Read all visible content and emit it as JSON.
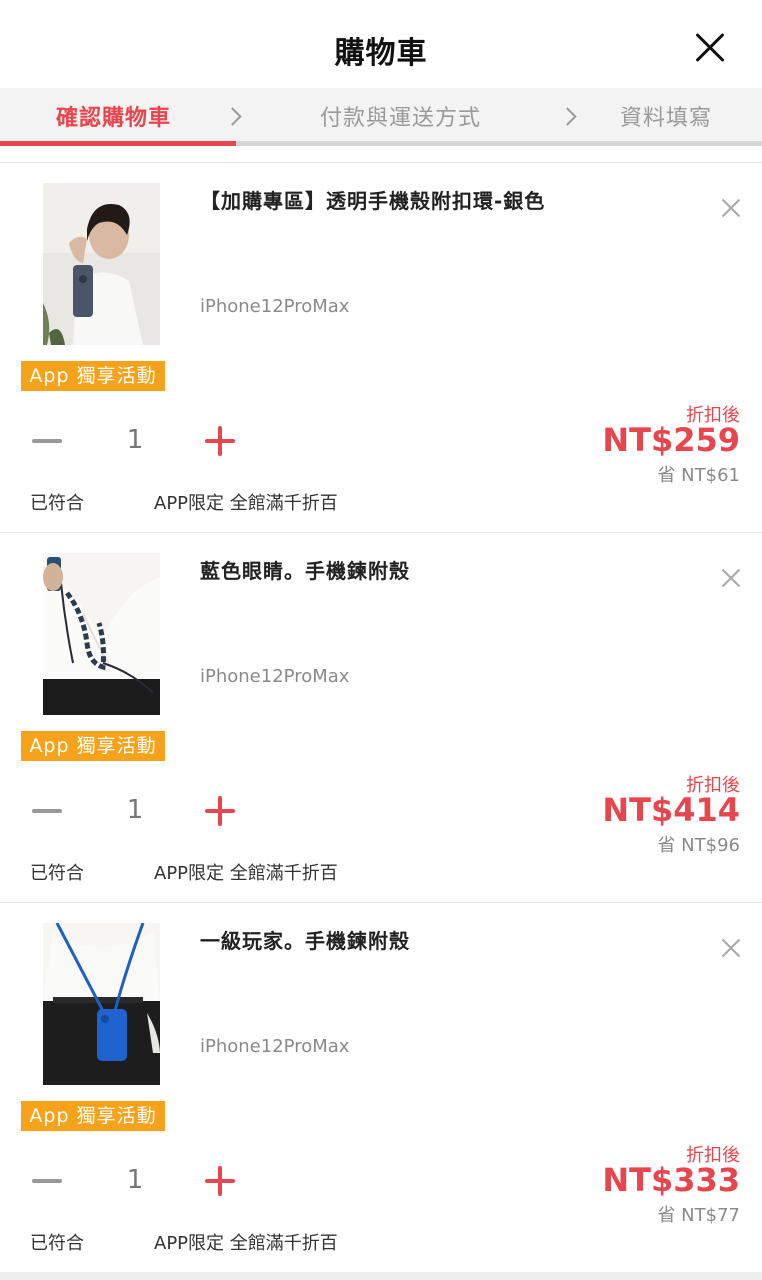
{
  "header": {
    "title": "購物車"
  },
  "steps": {
    "items": [
      {
        "label": "確認購物車",
        "active": true
      },
      {
        "label": "付款與運送方式",
        "active": false
      },
      {
        "label": "資料填寫",
        "active": false
      }
    ],
    "progress_fraction": 0.31
  },
  "items": [
    {
      "title": "【加購專區】透明手機殼附扣環-銀色",
      "variant": "iPhone12ProMax",
      "badge": "App 獨享活動",
      "quantity": "1",
      "price_label": "折扣後",
      "price": "NT$259",
      "savings": "省 NT$61",
      "promo_status": "已符合",
      "promo_name": "APP限定 全館滿千折百"
    },
    {
      "title": "藍色眼睛。手機鍊附殼",
      "variant": "iPhone12ProMax",
      "badge": "App 獨享活動",
      "quantity": "1",
      "price_label": "折扣後",
      "price": "NT$414",
      "savings": "省 NT$96",
      "promo_status": "已符合",
      "promo_name": "APP限定 全館滿千折百"
    },
    {
      "title": "一級玩家。手機鍊附殼",
      "variant": "iPhone12ProMax",
      "badge": "App 獨享活動",
      "quantity": "1",
      "price_label": "折扣後",
      "price": "NT$333",
      "savings": "省 NT$77",
      "promo_status": "已符合",
      "promo_name": "APP限定 全館滿千折百"
    }
  ],
  "colors": {
    "accent": "#e8464e",
    "badge": "#f7a21b",
    "muted": "#8a8a8a"
  }
}
